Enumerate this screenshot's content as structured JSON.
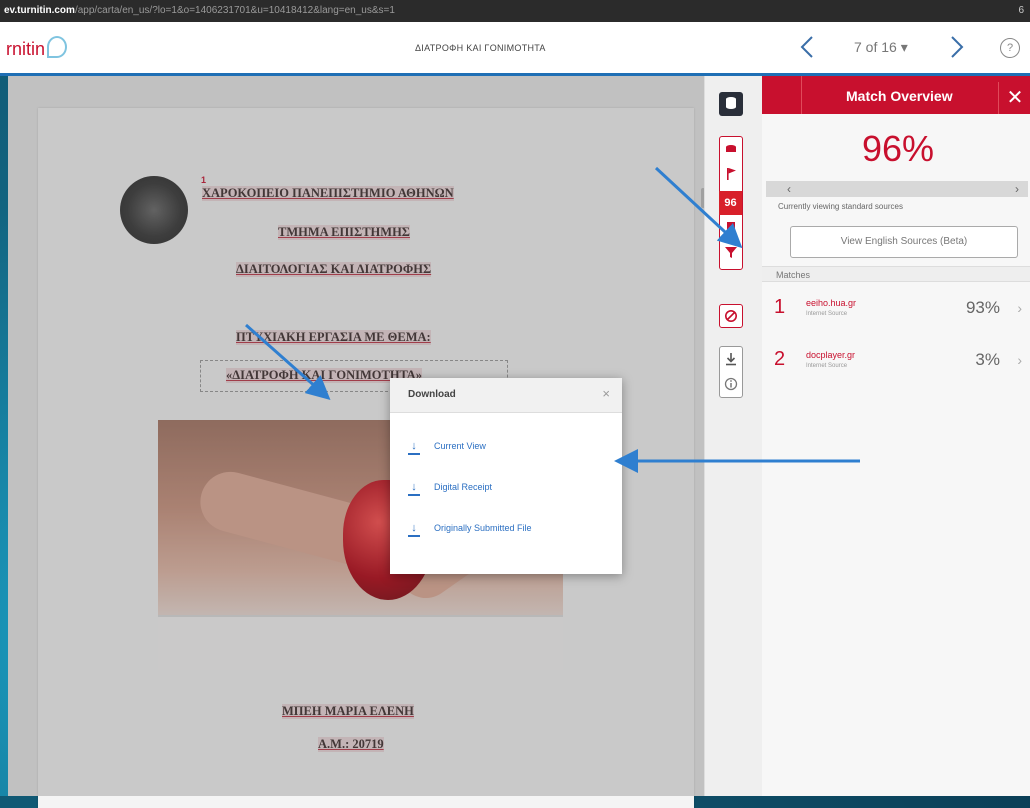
{
  "browser": {
    "url_host": "ev.turnitin.com",
    "url_path": "/app/carta/en_us/?lo=1&o=1406231701&u=10418412&lang=en_us&s=1",
    "ext_label": "6"
  },
  "header": {
    "logo_text": "rnitin",
    "doc_title": "ΔΙΑΤΡΟΦΗ ΚΑΙ ΓΟΝΙΜΟΤΗΤΑ",
    "page_count": "7 of 16 ▾",
    "help_glyph": "?"
  },
  "document": {
    "line1": "ΧΑΡΟΚΟΠΕΙΟ ΠΑΝΕΠΙΣΤΗΜΙΟ ΑΘΗΝΩΝ",
    "line2": "ΤΜΗΜΑ ΕΠΙΣΤΗΜΗΣ",
    "line3": "ΔΙΑΙΤΟΛΟΓΙΑΣ ΚΑΙ ΔΙΑΤΡΟΦΗΣ",
    "line4": "ΠΤΥΧΙΑΚΗ ΕΡΓΑΣΙΑ ΜΕ ΘΕΜΑ:",
    "line5": "«ΔΙΑΤΡΟΦΗ ΚΑΙ ΓΟΝΙΜΟΤΗΤΑ»",
    "author": "ΜΠΕΗ ΜΑΡΙΑ ΕΛΕΝΗ",
    "am": "Α.Μ.: 20719",
    "marker": "1"
  },
  "toolbar": {
    "score": "96",
    "db_icon": "database-icon",
    "flag_icon": "flag-icon",
    "filter_icon": "filter-icon",
    "exclude_icon": "exclude-icon",
    "download_icon": "download-icon",
    "info_icon": "info-icon"
  },
  "panel": {
    "title": "Match Overview",
    "close": "✕",
    "overall_score": "96%",
    "viewing_text": "Currently viewing standard sources",
    "english_button": "View English Sources (Beta)",
    "matches_label": "Matches",
    "matches": [
      {
        "num": "1",
        "source": "eeiho.hua.gr",
        "type": "Internet Source",
        "pct": "93%"
      },
      {
        "num": "2",
        "source": "docplayer.gr",
        "type": "Internet Source",
        "pct": "3%"
      }
    ]
  },
  "download": {
    "title": "Download",
    "close": "×",
    "items": [
      "Current View",
      "Digital Receipt",
      "Originally Submitted File"
    ]
  },
  "colors": {
    "accent": "#c8102e",
    "link": "#2b6fc2",
    "header_border": "#1f6fb5",
    "annotation_arrow": "#2f7fd0"
  }
}
